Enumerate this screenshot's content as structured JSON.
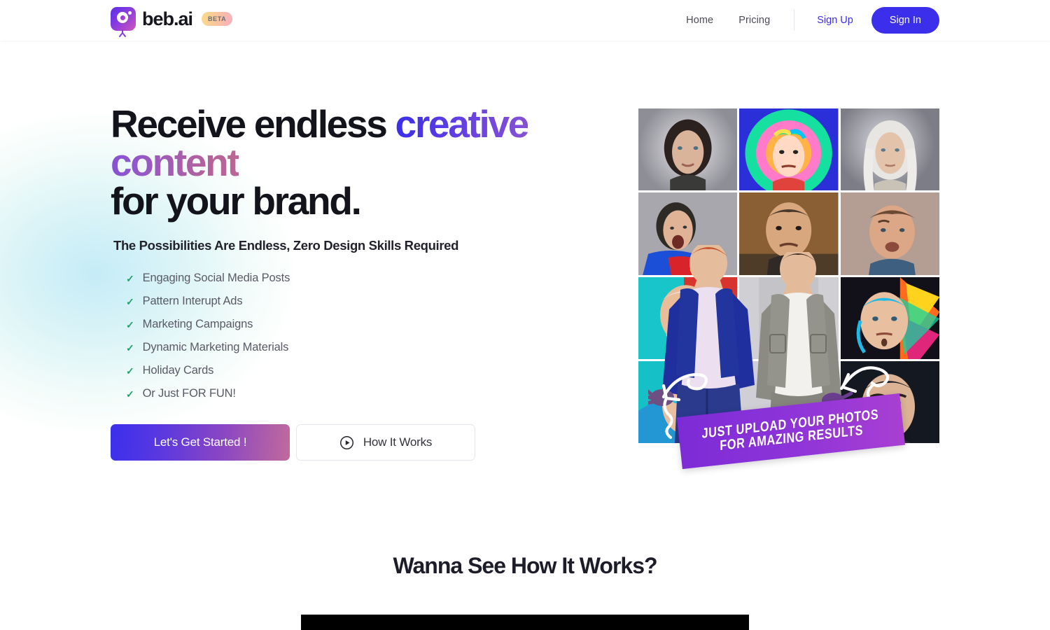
{
  "header": {
    "brand_name": "beb.ai",
    "beta_label": "BETA",
    "logo_icon": "camera-circle-icon",
    "nav": [
      {
        "label": "Home",
        "name": "nav-home"
      },
      {
        "label": "Pricing",
        "name": "nav-pricing"
      }
    ],
    "sign_up_label": "Sign Up",
    "sign_in_label": "Sign In"
  },
  "hero": {
    "headline_part1": "Receive endless ",
    "headline_highlight": "creative content",
    "headline_part2": "for your brand.",
    "subheadline": "The Possibilities Are Endless, Zero Design Skills Required",
    "features": [
      "Engaging Social Media Posts",
      "Pattern Interupt Ads",
      "Marketing Campaigns",
      "Dynamic Marketing Materials",
      "Holiday Cards",
      "Or Just FOR FUN!"
    ],
    "check_icon": "check-icon",
    "primary_cta": "Let's Get Started !",
    "secondary_cta": "How It Works",
    "play_icon": "play-circle-icon",
    "banner_line1": "JUST UPLOAD YOUR PHOTOS",
    "banner_line2": "FOR AMAZING RESULTS"
  },
  "section2": {
    "title": "Wanna See How It Works?"
  },
  "colors": {
    "accent_blue": "#3b2fec",
    "gradient_start": "#3b2fe8",
    "gradient_mid": "#8f56cf",
    "gradient_end": "#bc6694",
    "check_green": "#22a06b",
    "banner_purple": "#8b33d9",
    "beta_gradient_start": "#f7dd8a",
    "beta_gradient_end": "#f7aec0",
    "text_dark": "#13131c",
    "text_muted": "#5a5a66"
  }
}
